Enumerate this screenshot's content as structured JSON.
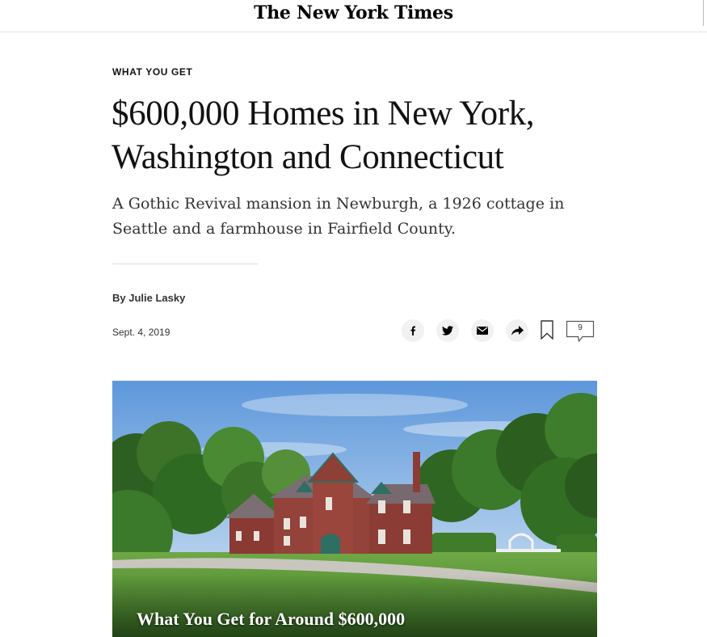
{
  "masthead": {
    "logo": "The New York Times"
  },
  "article": {
    "kicker": "WHAT YOU GET",
    "headline_line1": "$600,000 Homes in New York,",
    "headline_line2": "Washington and Connecticut",
    "summary_line1": "A Gothic Revival mansion in Newburgh, a 1926 cottage in",
    "summary_line2": "Seattle and a farmhouse in Fairfield County.",
    "byline": "By Julie Lasky",
    "date": "Sept. 4, 2019"
  },
  "share_tools": {
    "icons": [
      "facebook-icon",
      "twitter-icon",
      "email-icon",
      "share-arrow-icon",
      "bookmark-icon",
      "comment-icon"
    ],
    "comment_count": "9"
  },
  "hero": {
    "caption": "What You Get for Around $600,000"
  },
  "colors": {
    "text": "#121212",
    "share_bg": "#f1f1f1",
    "brick": "#8a3a33",
    "trim": "#2f6e63",
    "grass": "#5f9a3a",
    "sky": "#6fa6e0"
  }
}
